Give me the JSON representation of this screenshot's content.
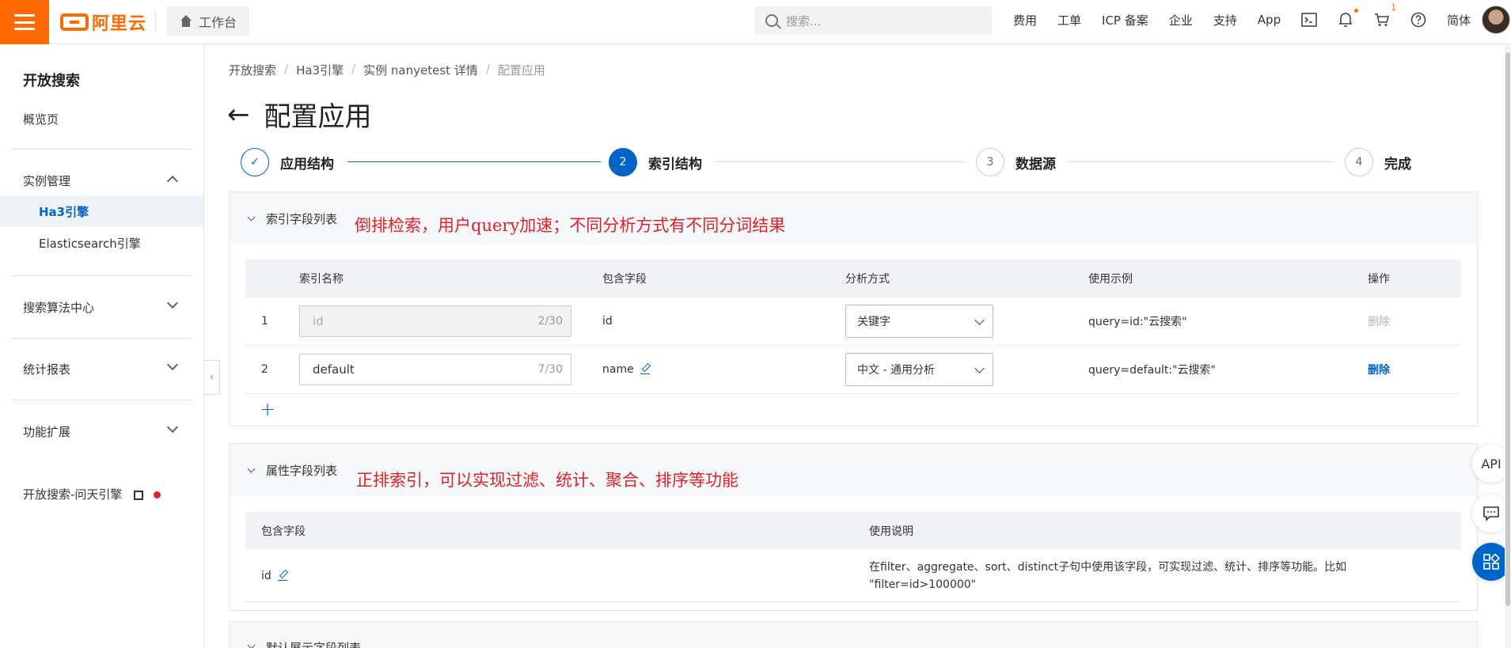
{
  "header": {
    "logo_text": "阿里云",
    "workbench_label": "工作台",
    "search_placeholder": "搜索...",
    "links": [
      "费用",
      "工单",
      "ICP 备案",
      "企业",
      "支持",
      "App"
    ],
    "cart_count": "1",
    "lang": "简体"
  },
  "sidebar": {
    "title": "开放搜索",
    "overview": "概览页",
    "instance_mgmt": "实例管理",
    "sub_items": [
      "Ha3引擎",
      "Elasticsearch引擎"
    ],
    "algo_center": "搜索算法中心",
    "reports": "统计报表",
    "extensions": "功能扩展",
    "wentian": "开放搜索-问天引擎"
  },
  "breadcrumb": [
    "开放搜索",
    "Ha3引擎",
    "实例 nanyetest 详情",
    "配置应用"
  ],
  "page_title": "配置应用",
  "steps": [
    {
      "num": "✓",
      "label": "应用结构",
      "state": "done"
    },
    {
      "num": "2",
      "label": "索引结构",
      "state": "current"
    },
    {
      "num": "3",
      "label": "数据源",
      "state": "todo"
    },
    {
      "num": "4",
      "label": "完成",
      "state": "todo"
    }
  ],
  "index_panel": {
    "title": "索引字段列表",
    "annotation": "倒排检索，用户query加速；不同分析方式有不同分词结果",
    "columns": [
      "索引名称",
      "包含字段",
      "分析方式",
      "使用示例",
      "操作"
    ],
    "rows": [
      {
        "num": "1",
        "name": "id",
        "count": "2/30",
        "field": "id",
        "analyzer": "关键字",
        "example": "query=id:\"云搜索\"",
        "action": "删除"
      },
      {
        "num": "2",
        "name": "default",
        "count": "7/30",
        "field": "name",
        "analyzer": "中文 - 通用分析",
        "example": "query=default:\"云搜索\"",
        "action": "删除"
      }
    ],
    "add": "+"
  },
  "attr_panel": {
    "title": "属性字段列表",
    "annotation": "正排索引，可以实现过滤、统计、聚合、排序等功能",
    "columns": [
      "包含字段",
      "使用说明"
    ],
    "row": {
      "field": "id",
      "desc_line1": "在filter、aggregate、sort、distinct子句中使用该字段，可实现过滤、统计、排序等功能。比如",
      "desc_line2": "\"filter=id>100000\""
    }
  },
  "next_panel": {
    "title": "默认展示字段列表"
  },
  "floating": {
    "api": "API"
  }
}
